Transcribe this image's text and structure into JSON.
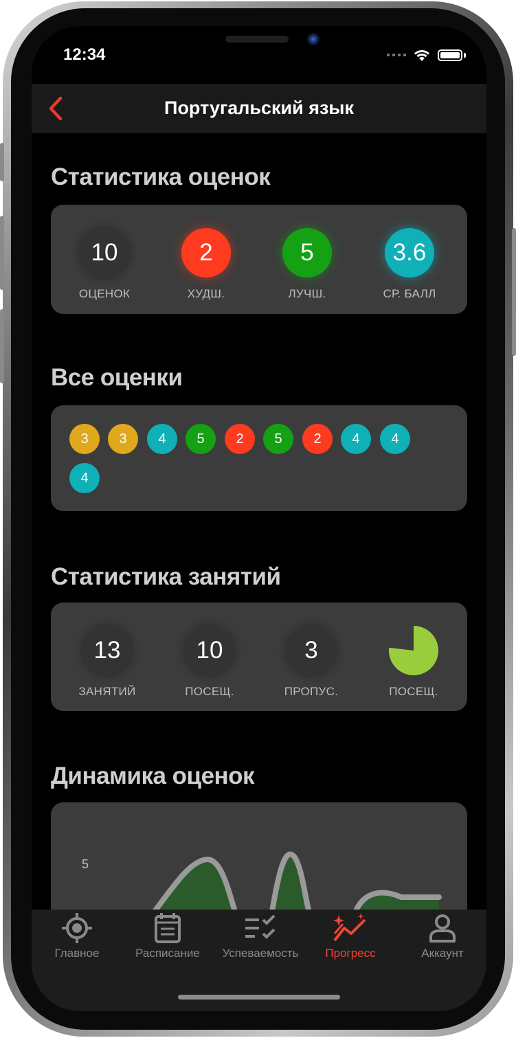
{
  "status_bar": {
    "time": "12:34"
  },
  "header": {
    "title": "Португальский язык"
  },
  "grade_stats": {
    "title": "Статистика оценок",
    "items": [
      {
        "value": "10",
        "label": "ОЦЕНОК",
        "color": "#333333"
      },
      {
        "value": "2",
        "label": "ХУДШ.",
        "color": "#ff3b1f"
      },
      {
        "value": "5",
        "label": "ЛУЧШ.",
        "color": "#14a214"
      },
      {
        "value": "3.6",
        "label": "СР. БАЛЛ",
        "color": "#10b0b8"
      }
    ]
  },
  "all_grades": {
    "title": "Все оценки",
    "grades": [
      {
        "value": "3",
        "color": "#e0a81c"
      },
      {
        "value": "3",
        "color": "#e0a81c"
      },
      {
        "value": "4",
        "color": "#10b0b8"
      },
      {
        "value": "5",
        "color": "#14a214"
      },
      {
        "value": "2",
        "color": "#ff3b1f"
      },
      {
        "value": "5",
        "color": "#14a214"
      },
      {
        "value": "2",
        "color": "#ff3b1f"
      },
      {
        "value": "4",
        "color": "#10b0b8"
      },
      {
        "value": "4",
        "color": "#10b0b8"
      },
      {
        "value": "4",
        "color": "#10b0b8"
      }
    ]
  },
  "lesson_stats": {
    "title": "Статистика занятий",
    "items": [
      {
        "value": "13",
        "label": "ЗАНЯТИЙ"
      },
      {
        "value": "10",
        "label": "ПОСЕЩ."
      },
      {
        "value": "3",
        "label": "ПРОПУС."
      }
    ],
    "attendance_pie": {
      "label": "ПОСЕЩ.",
      "fraction": 0.769,
      "color": "#9acd3c"
    }
  },
  "dynamics": {
    "title": "Динамика оценок",
    "y_tick": "5"
  },
  "tab_bar": {
    "tabs": [
      {
        "label": "Главное",
        "icon": "target-icon",
        "active": false
      },
      {
        "label": "Расписание",
        "icon": "calendar-icon",
        "active": false
      },
      {
        "label": "Успеваемость",
        "icon": "checklist-icon",
        "active": false
      },
      {
        "label": "Прогресс",
        "icon": "progress-chart-icon",
        "active": true
      },
      {
        "label": "Аккаунт",
        "icon": "user-icon",
        "active": false
      }
    ],
    "active_color": "#f04536"
  }
}
